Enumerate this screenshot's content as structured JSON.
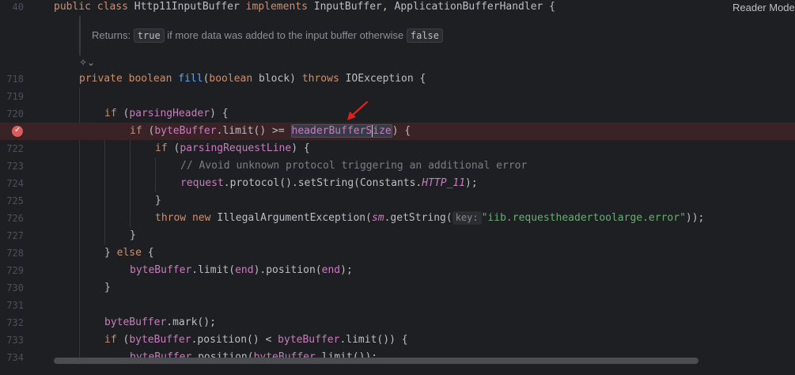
{
  "header": {
    "line_number": "40",
    "mode_label": "Reader Mode",
    "signature_parts": [
      "public",
      "class",
      "Http11InputBuffer",
      "implements",
      "InputBuffer, ApplicationBufferHandler {"
    ]
  },
  "doc": {
    "label": "Returns:",
    "code1": "true",
    "text": "if more data was added to the input buffer otherwise",
    "code2": "false"
  },
  "lines": [
    {
      "num": "718"
    },
    {
      "num": "719"
    },
    {
      "num": "720"
    },
    {
      "num": ""
    },
    {
      "num": "722"
    },
    {
      "num": "723"
    },
    {
      "num": "724"
    },
    {
      "num": "725"
    },
    {
      "num": "726"
    },
    {
      "num": "727"
    },
    {
      "num": "728"
    },
    {
      "num": "729"
    },
    {
      "num": "730"
    },
    {
      "num": "731"
    },
    {
      "num": "732"
    },
    {
      "num": "733"
    },
    {
      "num": "734"
    }
  ],
  "tokens": {
    "l718": [
      "private",
      "boolean",
      "fill",
      "(",
      "boolean",
      " block) ",
      "throws",
      " IOException {"
    ],
    "l720": [
      "if",
      " (",
      "parsingHeader",
      ") {"
    ],
    "l721": [
      "if",
      " (",
      "byteBuffer",
      ".limit() >= ",
      "headerBufferS",
      "ize",
      ") {"
    ],
    "l722": [
      "if",
      " (",
      "parsingRequestLine",
      ") {"
    ],
    "l723": "// Avoid unknown protocol triggering an additional error",
    "l724": [
      "request",
      ".protocol().setString(Constants.",
      "HTTP_11",
      ");"
    ],
    "l725": "}",
    "l726": [
      "throw",
      " ",
      "new",
      " IllegalArgumentException(",
      "sm",
      ".getString(",
      "key:",
      "\"iib.requestheadertoolarge.error\"",
      "));"
    ],
    "l727": "}",
    "l728": [
      "} ",
      "else",
      " {"
    ],
    "l729": [
      "byteBuffer",
      ".limit(",
      "end",
      ").position(",
      "end",
      ");"
    ],
    "l730": "}",
    "l732": [
      "byteBuffer",
      ".mark();"
    ],
    "l733": [
      "if",
      " (",
      "byteBuffer",
      ".position() < ",
      "byteBuffer",
      ".limit()) {"
    ],
    "l734": [
      "byteBuffer",
      ".position(",
      "byteBuffer",
      ".limit());"
    ]
  },
  "icons": {
    "breakpoint": "breakpoint-check-icon",
    "lens": "ai-lens-icon",
    "arrow": "red-arrow-annotation"
  },
  "colors": {
    "background": "#1e1f22",
    "keyword": "#cf8e6d",
    "method": "#56a8f5",
    "field": "#c77dbb",
    "string": "#6aab73",
    "comment": "#7a7e85",
    "breakpoint": "#db5c5c",
    "current_line": "#3a2326"
  }
}
